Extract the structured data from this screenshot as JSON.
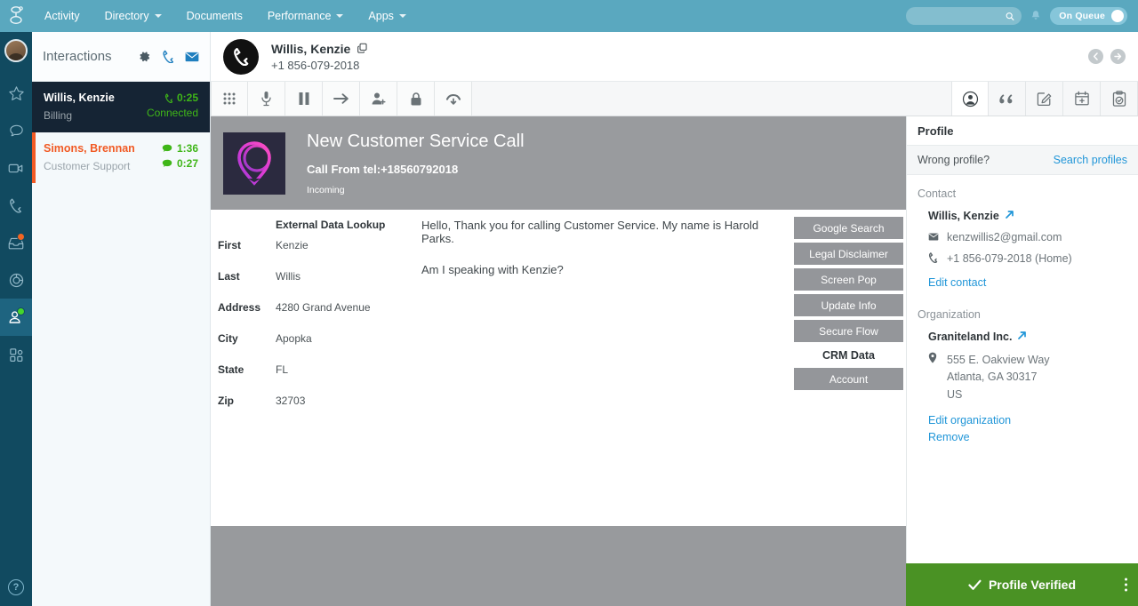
{
  "topnav": {
    "items": [
      {
        "label": "Activity",
        "caret": false
      },
      {
        "label": "Directory",
        "caret": true
      },
      {
        "label": "Documents",
        "caret": false
      },
      {
        "label": "Performance",
        "caret": true
      },
      {
        "label": "Apps",
        "caret": true
      }
    ],
    "search_placeholder": "",
    "search_value": "",
    "status_label": "On Queue",
    "brand_color": "#5aa8bf"
  },
  "rail": {
    "icons": [
      {
        "name": "avatar",
        "badge": null
      },
      {
        "name": "star-icon",
        "badge": null
      },
      {
        "name": "chat-icon",
        "badge": null
      },
      {
        "name": "video-icon",
        "badge": null
      },
      {
        "name": "phone-icon",
        "badge": null
      },
      {
        "name": "inbox-icon",
        "badge": "orange"
      },
      {
        "name": "target-icon",
        "badge": null
      },
      {
        "name": "person-icon",
        "badge": "green"
      },
      {
        "name": "apps-grid-icon",
        "badge": null
      }
    ],
    "help_label": "?"
  },
  "interactions": {
    "title": "Interactions",
    "items": [
      {
        "name": "Willis, Kenzie",
        "queue": "Billing",
        "timer": "0:25",
        "status": "Connected",
        "state": "selected",
        "type": "call"
      },
      {
        "name": "Simons, Brennan",
        "queue": "Customer Support",
        "timer": "1:36",
        "status": "0:27",
        "state": "alert",
        "type": "chat"
      }
    ]
  },
  "call_header": {
    "name": "Willis, Kenzie",
    "number": "+1 856-079-2018"
  },
  "toolbar": {
    "left": [
      {
        "name": "keypad-icon",
        "title": "Keypad"
      },
      {
        "name": "mute-icon",
        "title": "Mute"
      },
      {
        "name": "hold-icon",
        "title": "Hold"
      },
      {
        "name": "transfer-icon",
        "title": "Transfer"
      },
      {
        "name": "add-participant-icon",
        "title": "Add participant"
      },
      {
        "name": "secure-pause-icon",
        "title": "Secure pause"
      },
      {
        "name": "hangup-icon",
        "title": "Disconnect"
      }
    ],
    "right": [
      {
        "name": "profile-icon",
        "title": "Profile",
        "active": true
      },
      {
        "name": "script-quote-icon",
        "title": "Scripts",
        "active": false
      },
      {
        "name": "notes-icon",
        "title": "Notes",
        "active": false
      },
      {
        "name": "schedule-callback-icon",
        "title": "Callback",
        "active": false
      },
      {
        "name": "wrapup-icon",
        "title": "Wrap-up",
        "active": false
      }
    ]
  },
  "script": {
    "title": "New Customer Service Call",
    "subtitle": "Call From tel:+18560792018",
    "direction": "Incoming",
    "lookup_title": "External Data Lookup",
    "lookup_rows": [
      {
        "key": "First",
        "value": "Kenzie"
      },
      {
        "key": "Last",
        "value": "Willis"
      },
      {
        "key": "Address",
        "value": "4280 Grand Avenue"
      },
      {
        "key": "City",
        "value": "Apopka"
      },
      {
        "key": "State",
        "value": "FL"
      },
      {
        "key": "Zip",
        "value": "32703"
      }
    ],
    "lines": [
      "Hello, Thank you for calling Customer Service. My name is Harold Parks.",
      "Am I speaking with Kenzie?"
    ],
    "buttons": [
      {
        "label": "Google Search",
        "kind": "button"
      },
      {
        "label": "Legal Disclaimer",
        "kind": "button"
      },
      {
        "label": "Screen Pop",
        "kind": "button"
      },
      {
        "label": "Update Info",
        "kind": "button"
      },
      {
        "label": "Secure Flow",
        "kind": "button"
      },
      {
        "label": "CRM Data",
        "kind": "label"
      },
      {
        "label": "Account",
        "kind": "button"
      }
    ]
  },
  "profile": {
    "heading": "Profile",
    "wrong_profile_label": "Wrong profile?",
    "search_profiles_link": "Search profiles",
    "contact_label": "Contact",
    "contact_name": "Willis, Kenzie",
    "email": "kenzwillis2@gmail.com",
    "phone": "+1 856-079-2018 (Home)",
    "edit_contact_link": "Edit contact",
    "organization_label": "Organization",
    "organization_name": "Graniteland Inc.",
    "address_line1": "555 E. Oakview Way",
    "address_line2": "Atlanta, GA 30317",
    "address_line3": "US",
    "edit_organization_link": "Edit organization",
    "remove_link": "Remove",
    "verified_label": "Profile Verified",
    "verified_color": "#4a9224"
  }
}
